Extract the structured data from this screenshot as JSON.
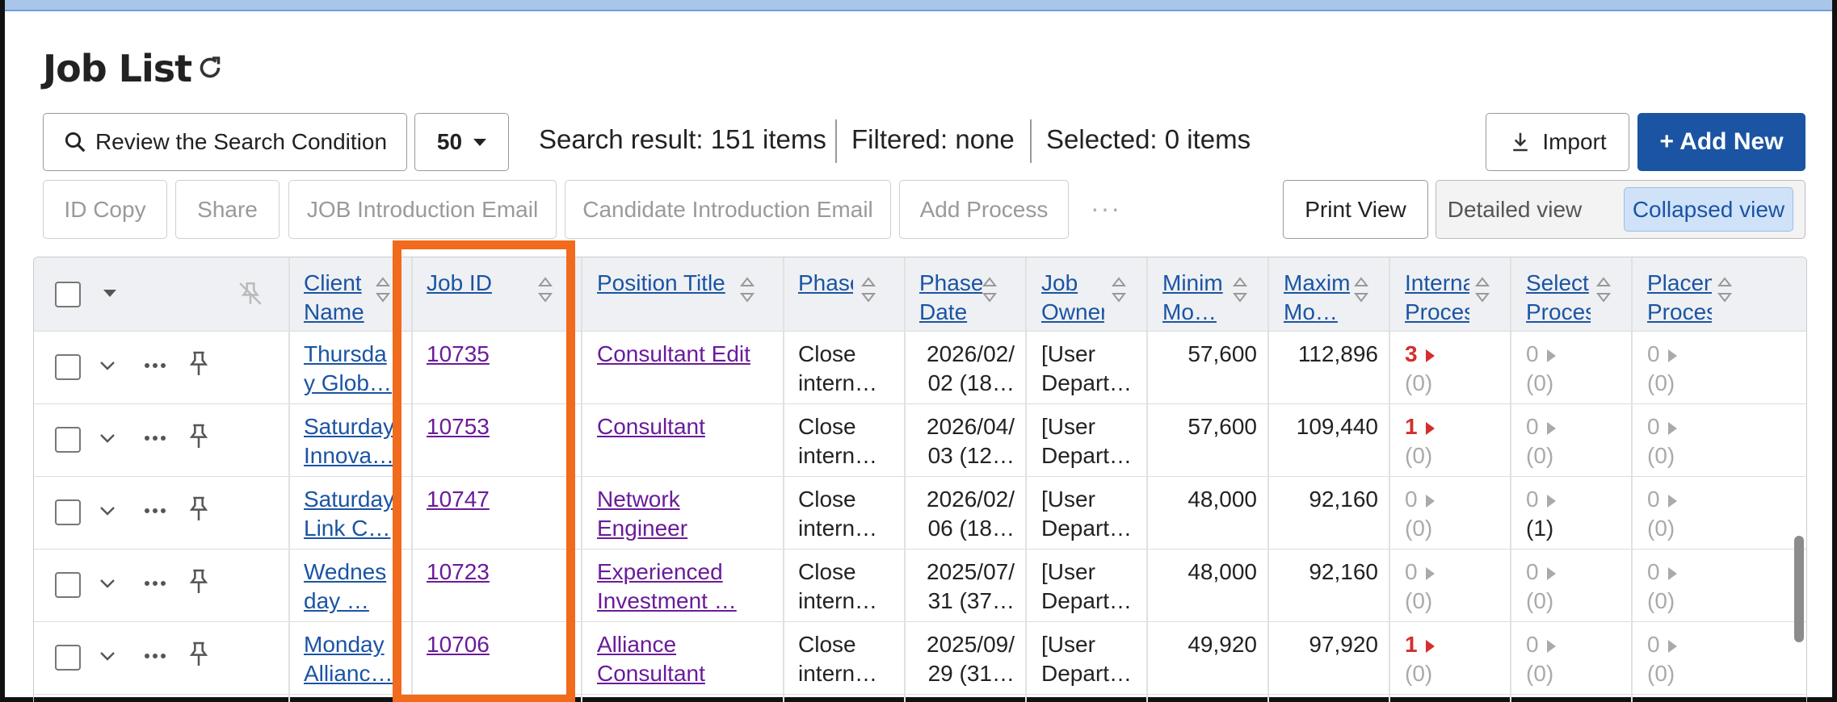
{
  "page": {
    "title": "Job List"
  },
  "toolbar": {
    "search_button": "Review the Search Condition",
    "per_page": "50",
    "search_result": "Search result: 151 items",
    "filtered": "Filtered: none",
    "selected": "Selected:  0 items",
    "import": "Import",
    "add_new": "+ Add New"
  },
  "actions": {
    "id_copy": "ID Copy",
    "share": "Share",
    "job_email": "JOB Introduction Email",
    "candidate_email": "Candidate Introduction Email",
    "add_process": "Add Process",
    "more": "···",
    "print_view": "Print View",
    "detailed_view": "Detailed view",
    "collapsed_view": "Collapsed view"
  },
  "table": {
    "headers": {
      "client": "Client Name",
      "job_id": "Job ID",
      "position": "Position Title",
      "phase": "Phase",
      "phase_date": "Phase Date",
      "owner": "Job Owner",
      "min": "Minim Mo…",
      "max": "Maxim Mo…",
      "internal": "Interna Proces",
      "select": "Select Proces",
      "placement": "Placem Proces"
    },
    "rows": [
      {
        "client": "Thursda y Glob…",
        "job_id": "10735",
        "position": "Consultant Edit",
        "phase": "Close intern…",
        "phase_date": "2026/02/ 02 (18…",
        "owner": "[User Depart…",
        "min": "57,600",
        "max": "112,896",
        "internal": "3",
        "internal_sub": "(0)",
        "select": "0",
        "select_sub": "(0)",
        "placement": "0",
        "placement_sub": "(0)"
      },
      {
        "client": "Saturday Innova…",
        "job_id": "10753",
        "position": "Consultant",
        "phase": "Close intern…",
        "phase_date": "2026/04/ 03 (12…",
        "owner": "[User Depart…",
        "min": "57,600",
        "max": "109,440",
        "internal": "1",
        "internal_sub": "(0)",
        "select": "0",
        "select_sub": "(0)",
        "placement": "0",
        "placement_sub": "(0)"
      },
      {
        "client": "Saturday Link C…",
        "job_id": "10747",
        "position": "Network Engineer",
        "phase": "Close intern…",
        "phase_date": "2026/02/ 06 (18…",
        "owner": "[User Depart…",
        "min": "48,000",
        "max": "92,160",
        "internal": "0",
        "internal_sub": "(0)",
        "select": "0",
        "select_sub": "(1)",
        "placement": "0",
        "placement_sub": "(0)"
      },
      {
        "client": "Wednes day …",
        "job_id": "10723",
        "position": "Experienced Investment …",
        "phase": "Close intern…",
        "phase_date": "2025/07/ 31 (37…",
        "owner": "[User Depart…",
        "min": "48,000",
        "max": "92,160",
        "internal": "0",
        "internal_sub": "(0)",
        "select": "0",
        "select_sub": "(0)",
        "placement": "0",
        "placement_sub": "(0)"
      },
      {
        "client": "Monday Allianc…",
        "job_id": "10706",
        "position": "Alliance Consultant",
        "phase": "Close intern…",
        "phase_date": "2025/09/ 29 (31…",
        "owner": "[User Depart…",
        "min": "49,920",
        "max": "97,920",
        "internal": "1",
        "internal_sub": "(0)",
        "select": "0",
        "select_sub": "(0)",
        "placement": "0",
        "placement_sub": "(0)"
      }
    ]
  },
  "colors": {
    "accent": "#1b54a3",
    "highlight": "#f26a1b",
    "alert": "#d32f2f"
  }
}
